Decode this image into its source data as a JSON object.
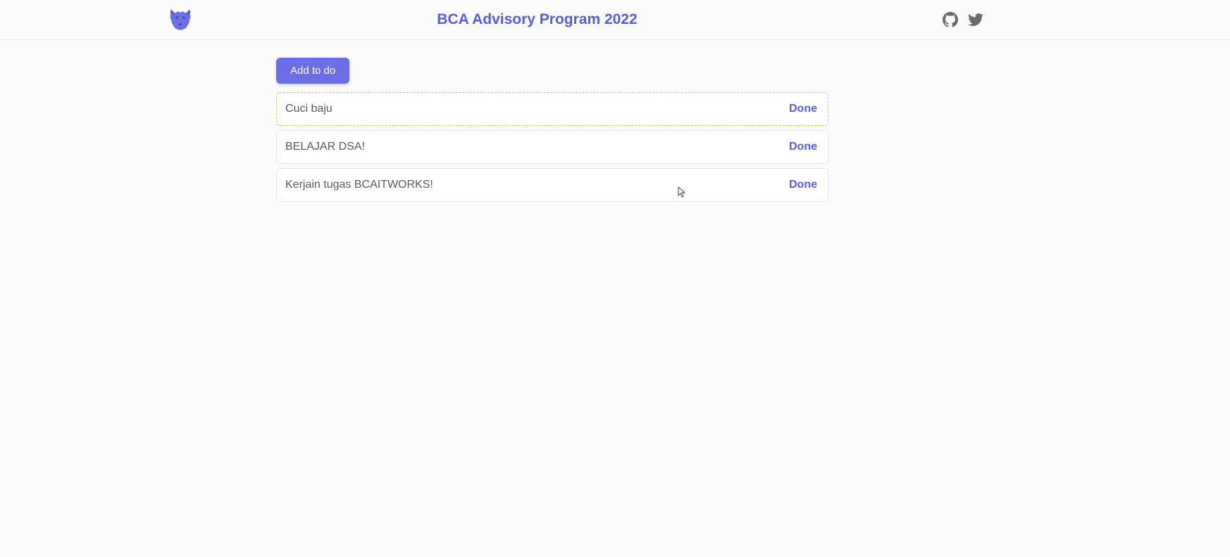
{
  "header": {
    "title": "BCA Advisory Program 2022"
  },
  "toolbar": {
    "add_label": "Add to do"
  },
  "todos": [
    {
      "text": "Cuci baju",
      "action": "Done",
      "highlight": true
    },
    {
      "text": "BELAJAR DSA!",
      "action": "Done",
      "highlight": false
    },
    {
      "text": "Kerjain tugas BCAITWORKS!",
      "action": "Done",
      "highlight": false
    }
  ]
}
